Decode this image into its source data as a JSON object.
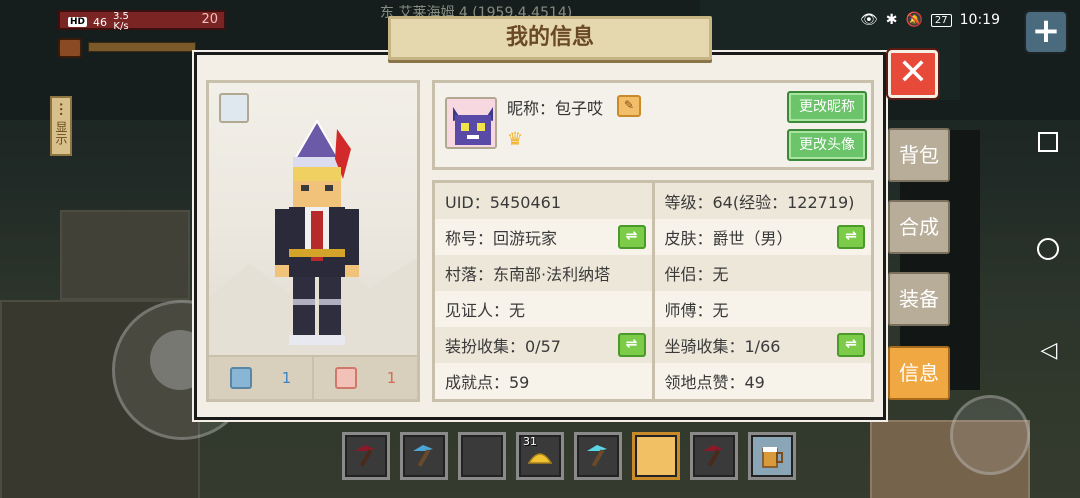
{
  "status_bar": {
    "hd": "HD",
    "signal": "46",
    "speed": "3.5",
    "speed_unit": "K/s",
    "battery": "27",
    "time": "10:19"
  },
  "hud": {
    "health_value": "20",
    "side_display_label": "显示",
    "background_coords": "东 艾莱海姆 4 (1959,4,4514)"
  },
  "dialog": {
    "title": "我的信息",
    "close_label": "✕"
  },
  "side_tabs": [
    {
      "label": "背包",
      "active": false
    },
    {
      "label": "合成",
      "active": false
    },
    {
      "label": "装备",
      "active": false
    },
    {
      "label": "信息",
      "active": true
    }
  ],
  "character": {
    "left_stat_value": "1",
    "right_stat_value": "1"
  },
  "profile": {
    "nickname": "昵称：包子哎",
    "change_nickname_button": "更改昵称",
    "change_avatar_button": "更改头像"
  },
  "info": {
    "left": [
      {
        "text": "UID：5450461",
        "swap": false
      },
      {
        "text": "称号：回游玩家",
        "swap": true
      },
      {
        "text": "村落：东南部·法利纳塔",
        "swap": false
      },
      {
        "text": "见证人：无",
        "swap": false
      },
      {
        "text": "装扮收集：0/57",
        "swap": true
      },
      {
        "text": "成就点：59",
        "swap": false
      }
    ],
    "right": [
      {
        "text": "等级：64(经验：122719)",
        "swap": false
      },
      {
        "text": "皮肤：爵世（男）",
        "swap": true
      },
      {
        "text": "伴侣：无",
        "swap": false
      },
      {
        "text": "师傅：无",
        "swap": false
      },
      {
        "text": "坐骑收集：1/66",
        "swap": true
      },
      {
        "text": "领地点赞：49",
        "swap": false
      }
    ],
    "swap_symbol": "⇌"
  },
  "hotbar": {
    "slots": [
      {
        "item": "pickaxe-dark",
        "count": "",
        "selected": false
      },
      {
        "item": "pickaxe-blue",
        "count": "",
        "selected": false
      },
      {
        "item": "empty",
        "count": "",
        "selected": false
      },
      {
        "item": "melon-slice",
        "count": "31",
        "selected": false
      },
      {
        "item": "diamond-pickaxe",
        "count": "",
        "selected": false
      },
      {
        "item": "empty",
        "count": "",
        "selected": true
      },
      {
        "item": "pickaxe-dark",
        "count": "",
        "selected": false
      },
      {
        "item": "beer-mug",
        "count": "",
        "selected": false
      }
    ]
  },
  "background": {
    "level_text": "等级：64"
  },
  "colors": {
    "accent_orange": "#f0a842",
    "close_red": "#e84a3a",
    "green_button": "#6bc46a",
    "panel_bg": "#f3efe6"
  }
}
